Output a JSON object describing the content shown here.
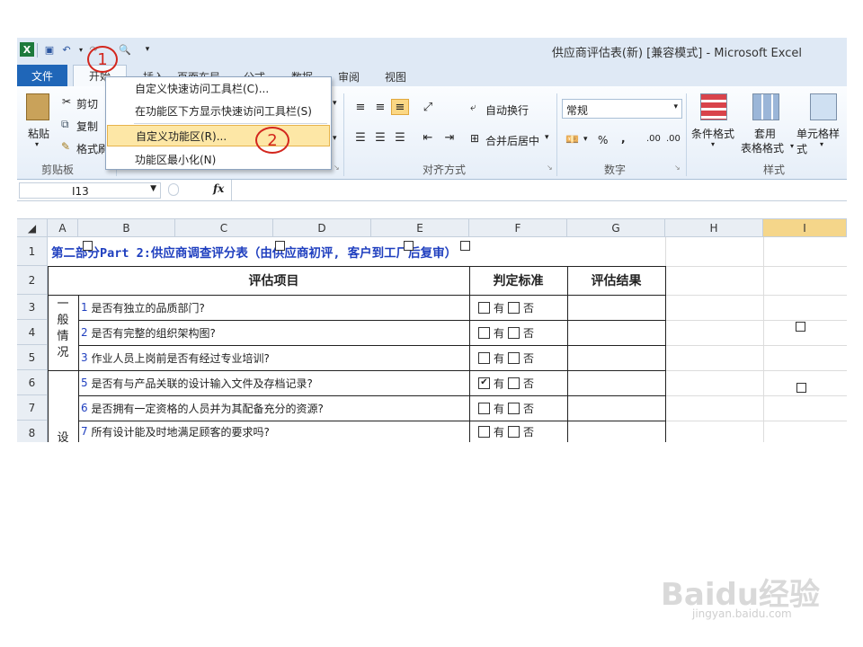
{
  "window": {
    "title": "供应商评估表(新) [兼容模式] - Microsoft Excel"
  },
  "tabs": [
    "文件",
    "开始",
    "插入",
    "页面布局",
    "公式",
    "数据",
    "审阅",
    "视图"
  ],
  "clipboard": {
    "paste": "粘贴",
    "cut": "剪切",
    "copy": "复制",
    "format_painter": "格式刷",
    "group": "剪贴板"
  },
  "alignment": {
    "wrap": "自动换行",
    "merge": "合并后居中",
    "group": "对齐方式"
  },
  "number": {
    "format": "常规",
    "percent": "%",
    "comma": ",",
    "inc_decimal": ".00",
    "dec_decimal": ".00",
    "group": "数字"
  },
  "styles": {
    "conditional": "条件格式",
    "table_line1": "套用",
    "table_line2": "表格格式",
    "cell": "单元格样式",
    "group": "样式"
  },
  "menu": {
    "items": [
      "自定义快速访问工具栏(C)...",
      "在功能区下方显示快速访问工具栏(S)",
      "自定义功能区(R)...",
      "功能区最小化(N)"
    ],
    "highlighted_index": 2
  },
  "annotations": [
    "1",
    "2"
  ],
  "formula_bar": {
    "name_box": "I13",
    "fx": "fx",
    "formula": ""
  },
  "sheet": {
    "columns": [
      "A",
      "B",
      "C",
      "D",
      "E",
      "F",
      "G",
      "H",
      "I"
    ],
    "rows": [
      "1",
      "2",
      "3",
      "4",
      "5",
      "6",
      "7",
      "8"
    ],
    "title_row": "第二部分Part 2:供应商调查评分表（由供应商初评, 客户到工厂后复审）",
    "headers": {
      "item": "评估项目",
      "criteria": "判定标准",
      "result": "评估结果"
    },
    "section_general": [
      "一",
      "般",
      "情",
      "况"
    ],
    "section_design": "设",
    "items": [
      {
        "num": "1",
        "text": "是否有独立的品质部门?",
        "checked_yes": false
      },
      {
        "num": "2",
        "text": "是否有完整的组织架构图?",
        "checked_yes": false
      },
      {
        "num": "3",
        "text": "作业人员上岗前是否有经过专业培训?",
        "checked_yes": false
      },
      {
        "num": "5",
        "text": "是否有与产品关联的设计输入文件及存档记录?",
        "checked_yes": true
      },
      {
        "num": "6",
        "text": "是否拥有一定资格的人员并为其配备充分的资源?",
        "checked_yes": false
      },
      {
        "num": "7",
        "text": "所有设计能及时地满足顾客的要求吗?",
        "checked_yes": false
      }
    ],
    "yes_label": "有",
    "no_label": "否"
  },
  "watermark": {
    "brand": "Baidu经验",
    "url": "jingyan.baidu.com"
  },
  "colors": {
    "file_tab": "#1f66b8",
    "accent_red": "#d3261d",
    "title_blue": "#1f3fbf",
    "title_red": "#d3261d",
    "menu_highlight": "#fde7a6"
  }
}
